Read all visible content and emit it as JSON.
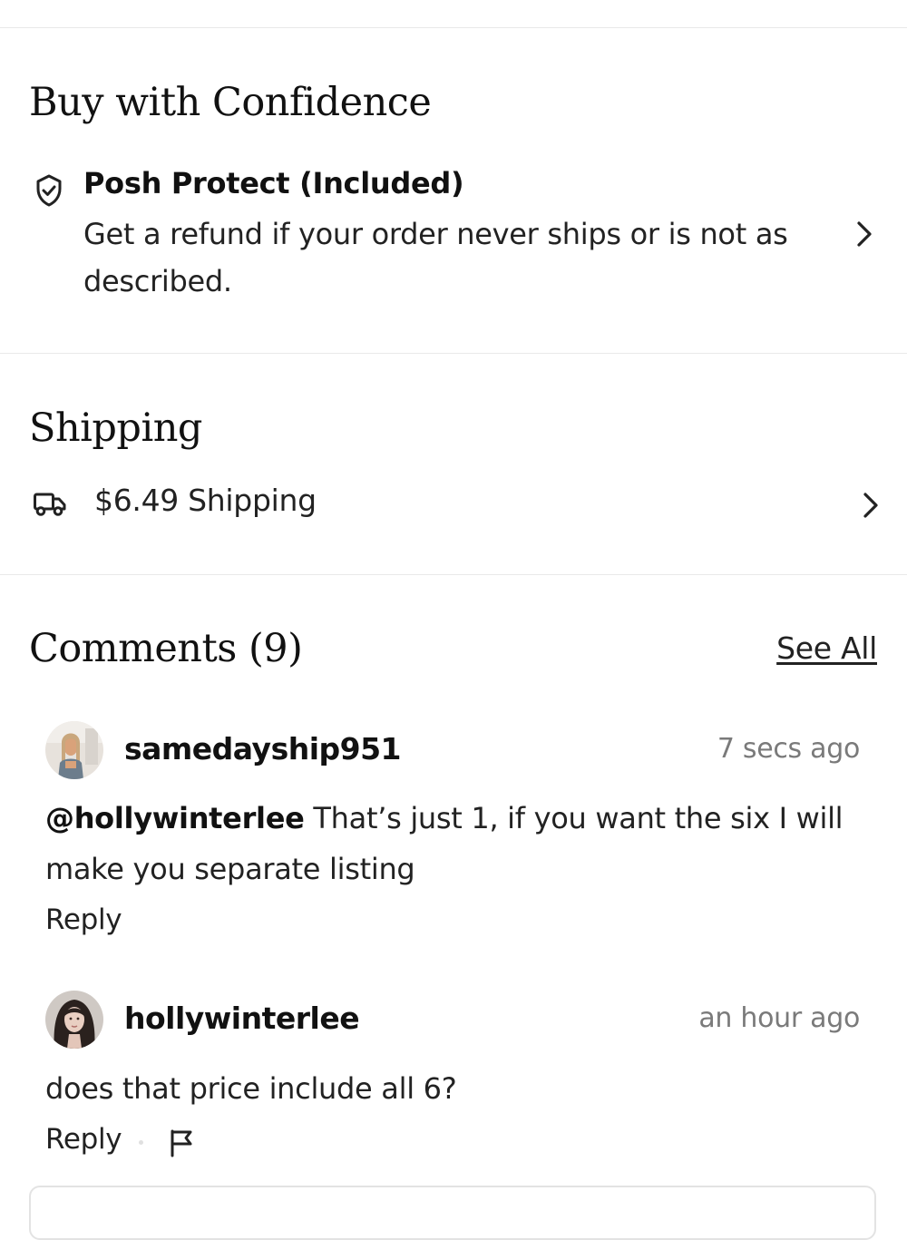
{
  "buy_with_confidence": {
    "heading": "Buy with Confidence",
    "posh_protect": {
      "title": "Posh Protect (Included)",
      "description": "Get a refund if your order never ships or is not as described."
    }
  },
  "shipping": {
    "heading": "Shipping",
    "label": "$6.49 Shipping"
  },
  "comments": {
    "heading": "Comments (9)",
    "see_all_label": "See All",
    "items": [
      {
        "username": "samedayship951",
        "timestamp": "7 secs ago",
        "mention": "@hollywinterlee",
        "text": " That’s just 1, if you want the six I will make you separate listing",
        "reply_label": "Reply"
      },
      {
        "username": "hollywinterlee",
        "timestamp": "an hour ago",
        "mention": "",
        "text": "does that price include all 6?",
        "reply_label": "Reply"
      }
    ]
  },
  "icons": {
    "posh_protect": "shield-check-icon",
    "shipping": "truck-icon",
    "report": "flag-icon",
    "navigate": "chevron-right-icon"
  }
}
